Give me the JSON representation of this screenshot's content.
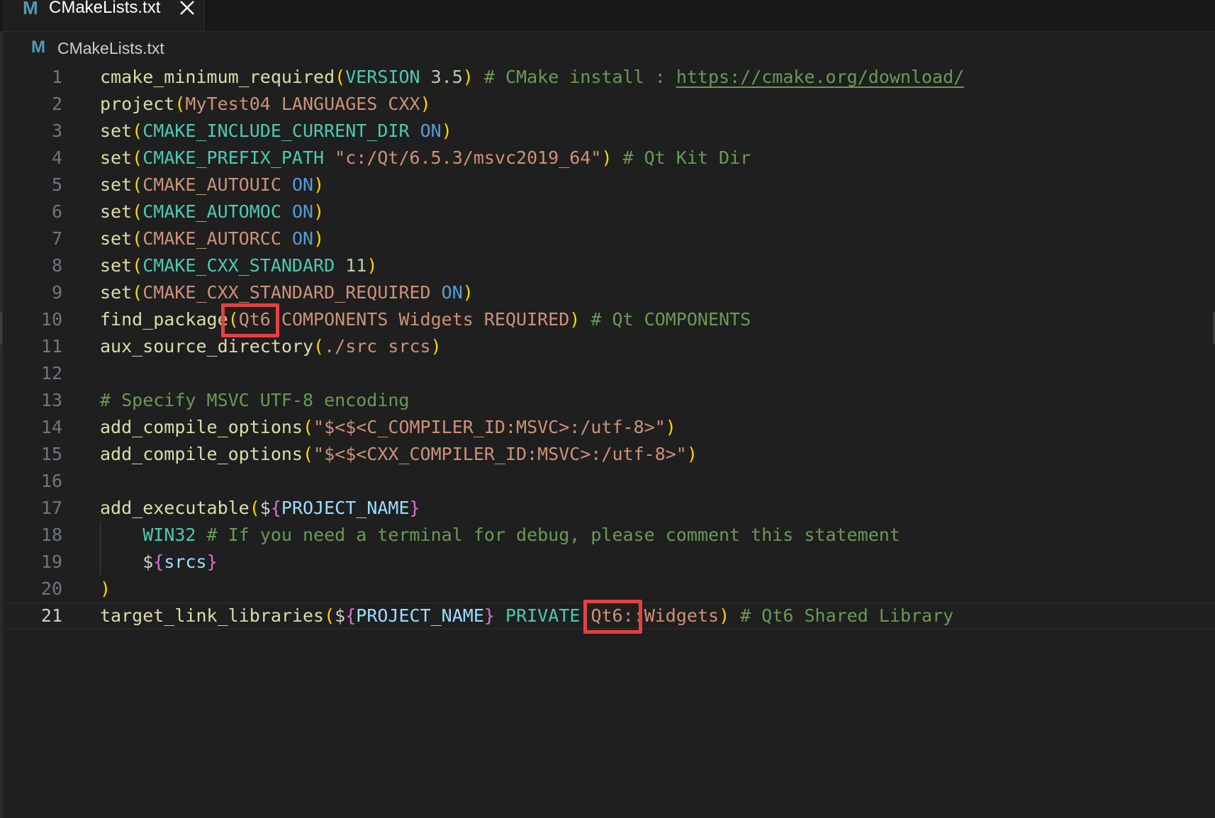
{
  "tab": {
    "icon": "M",
    "label": "CMakeLists.txt"
  },
  "breadcrumb": {
    "icon": "M",
    "label": "CMakeLists.txt"
  },
  "lines": [
    {
      "n": "1",
      "tokens": [
        {
          "t": "cmake_minimum_required",
          "c": "fn"
        },
        {
          "t": "(",
          "c": "br1"
        },
        {
          "t": "VERSION",
          "c": "kw"
        },
        {
          "t": " ",
          "c": "plain"
        },
        {
          "t": "3.5",
          "c": "num"
        },
        {
          "t": ")",
          "c": "br1"
        },
        {
          "t": " # CMake install : ",
          "c": "com"
        },
        {
          "t": "https://cmake.org/download/",
          "c": "url"
        }
      ]
    },
    {
      "n": "2",
      "tokens": [
        {
          "t": "project",
          "c": "fn"
        },
        {
          "t": "(",
          "c": "br1"
        },
        {
          "t": "MyTest04 LANGUAGES CXX",
          "c": "str"
        },
        {
          "t": ")",
          "c": "br1"
        }
      ]
    },
    {
      "n": "3",
      "tokens": [
        {
          "t": "set",
          "c": "fn"
        },
        {
          "t": "(",
          "c": "br1"
        },
        {
          "t": "CMAKE_INCLUDE_CURRENT_DIR",
          "c": "kw"
        },
        {
          "t": " ",
          "c": "plain"
        },
        {
          "t": "ON",
          "c": "const"
        },
        {
          "t": ")",
          "c": "br1"
        }
      ]
    },
    {
      "n": "4",
      "tokens": [
        {
          "t": "set",
          "c": "fn"
        },
        {
          "t": "(",
          "c": "br1"
        },
        {
          "t": "CMAKE_PREFIX_PATH",
          "c": "kw"
        },
        {
          "t": " ",
          "c": "plain"
        },
        {
          "t": "\"c:/Qt/6.5.3/msvc2019_64\"",
          "c": "str"
        },
        {
          "t": ")",
          "c": "br1"
        },
        {
          "t": " # Qt Kit Dir",
          "c": "com"
        }
      ]
    },
    {
      "n": "5",
      "tokens": [
        {
          "t": "set",
          "c": "fn"
        },
        {
          "t": "(",
          "c": "br1"
        },
        {
          "t": "CMAKE_AUTOUIC",
          "c": "str"
        },
        {
          "t": " ",
          "c": "plain"
        },
        {
          "t": "ON",
          "c": "const"
        },
        {
          "t": ")",
          "c": "br1"
        }
      ]
    },
    {
      "n": "6",
      "tokens": [
        {
          "t": "set",
          "c": "fn"
        },
        {
          "t": "(",
          "c": "br1"
        },
        {
          "t": "CMAKE_AUTOMOC",
          "c": "kw"
        },
        {
          "t": " ",
          "c": "plain"
        },
        {
          "t": "ON",
          "c": "const"
        },
        {
          "t": ")",
          "c": "br1"
        }
      ]
    },
    {
      "n": "7",
      "tokens": [
        {
          "t": "set",
          "c": "fn"
        },
        {
          "t": "(",
          "c": "br1"
        },
        {
          "t": "CMAKE_AUTORCC",
          "c": "str"
        },
        {
          "t": " ",
          "c": "plain"
        },
        {
          "t": "ON",
          "c": "const"
        },
        {
          "t": ")",
          "c": "br1"
        }
      ]
    },
    {
      "n": "8",
      "tokens": [
        {
          "t": "set",
          "c": "fn"
        },
        {
          "t": "(",
          "c": "br1"
        },
        {
          "t": "CMAKE_CXX_STANDARD",
          "c": "kw"
        },
        {
          "t": " ",
          "c": "plain"
        },
        {
          "t": "11",
          "c": "num"
        },
        {
          "t": ")",
          "c": "br1"
        }
      ]
    },
    {
      "n": "9",
      "tokens": [
        {
          "t": "set",
          "c": "fn"
        },
        {
          "t": "(",
          "c": "br1"
        },
        {
          "t": "CMAKE_CXX_STANDARD_REQUIRED",
          "c": "str"
        },
        {
          "t": " ",
          "c": "plain"
        },
        {
          "t": "ON",
          "c": "const"
        },
        {
          "t": ")",
          "c": "br1"
        }
      ]
    },
    {
      "n": "10",
      "tokens": [
        {
          "t": "find_package",
          "c": "fn"
        },
        {
          "t": "(",
          "c": "br1"
        },
        {
          "t": "Qt6 COMPONENTS Widgets REQUIRED",
          "c": "str"
        },
        {
          "t": ")",
          "c": "br1"
        },
        {
          "t": " # Qt COMPONENTS",
          "c": "com"
        }
      ]
    },
    {
      "n": "11",
      "tokens": [
        {
          "t": "aux_source_directory",
          "c": "fn"
        },
        {
          "t": "(",
          "c": "br1"
        },
        {
          "t": "./src srcs",
          "c": "str"
        },
        {
          "t": ")",
          "c": "br1"
        }
      ]
    },
    {
      "n": "12",
      "tokens": []
    },
    {
      "n": "13",
      "tokens": [
        {
          "t": "# Specify MSVC UTF-8 encoding",
          "c": "com"
        }
      ]
    },
    {
      "n": "14",
      "tokens": [
        {
          "t": "add_compile_options",
          "c": "fn"
        },
        {
          "t": "(",
          "c": "br1"
        },
        {
          "t": "\"$<$<C_COMPILER_ID:MSVC>:/utf-8>\"",
          "c": "str"
        },
        {
          "t": ")",
          "c": "br1"
        }
      ]
    },
    {
      "n": "15",
      "tokens": [
        {
          "t": "add_compile_options",
          "c": "fn"
        },
        {
          "t": "(",
          "c": "br1"
        },
        {
          "t": "\"$<$<CXX_COMPILER_ID:MSVC>:/utf-8>\"",
          "c": "str"
        },
        {
          "t": ")",
          "c": "br1"
        }
      ]
    },
    {
      "n": "16",
      "tokens": []
    },
    {
      "n": "17",
      "tokens": [
        {
          "t": "add_executable",
          "c": "fn"
        },
        {
          "t": "(",
          "c": "br1"
        },
        {
          "t": "$",
          "c": "dollar"
        },
        {
          "t": "{",
          "c": "br2"
        },
        {
          "t": "PROJECT_NAME",
          "c": "var"
        },
        {
          "t": "}",
          "c": "br2"
        }
      ]
    },
    {
      "n": "18",
      "guide": true,
      "tokens": [
        {
          "t": "    ",
          "c": "plain"
        },
        {
          "t": "WIN32",
          "c": "kw"
        },
        {
          "t": " # If you need a terminal for debug, please comment this statement",
          "c": "com"
        }
      ]
    },
    {
      "n": "19",
      "guide": true,
      "tokens": [
        {
          "t": "    ",
          "c": "plain"
        },
        {
          "t": "$",
          "c": "dollar"
        },
        {
          "t": "{",
          "c": "br2"
        },
        {
          "t": "srcs",
          "c": "var"
        },
        {
          "t": "}",
          "c": "br2"
        }
      ]
    },
    {
      "n": "20",
      "tokens": [
        {
          "t": ")",
          "c": "br1"
        }
      ]
    },
    {
      "n": "21",
      "current": true,
      "tokens": [
        {
          "t": "target_link_libraries",
          "c": "fn"
        },
        {
          "t": "(",
          "c": "br1"
        },
        {
          "t": "$",
          "c": "dollar"
        },
        {
          "t": "{",
          "c": "br2"
        },
        {
          "t": "PROJECT_NAME",
          "c": "var"
        },
        {
          "t": "}",
          "c": "br2"
        },
        {
          "t": " ",
          "c": "plain"
        },
        {
          "t": "PRIVATE",
          "c": "kw"
        },
        {
          "t": " ",
          "c": "plain"
        },
        {
          "t": "Qt6::Widgets",
          "c": "str"
        },
        {
          "t": ")",
          "c": "br1"
        },
        {
          "t": " # Qt6 Shared Library",
          "c": "com"
        }
      ]
    }
  ],
  "colors": {
    "background": "#1f1f1f",
    "highlight_box": "#e84040",
    "file_icon": "#519aba"
  }
}
